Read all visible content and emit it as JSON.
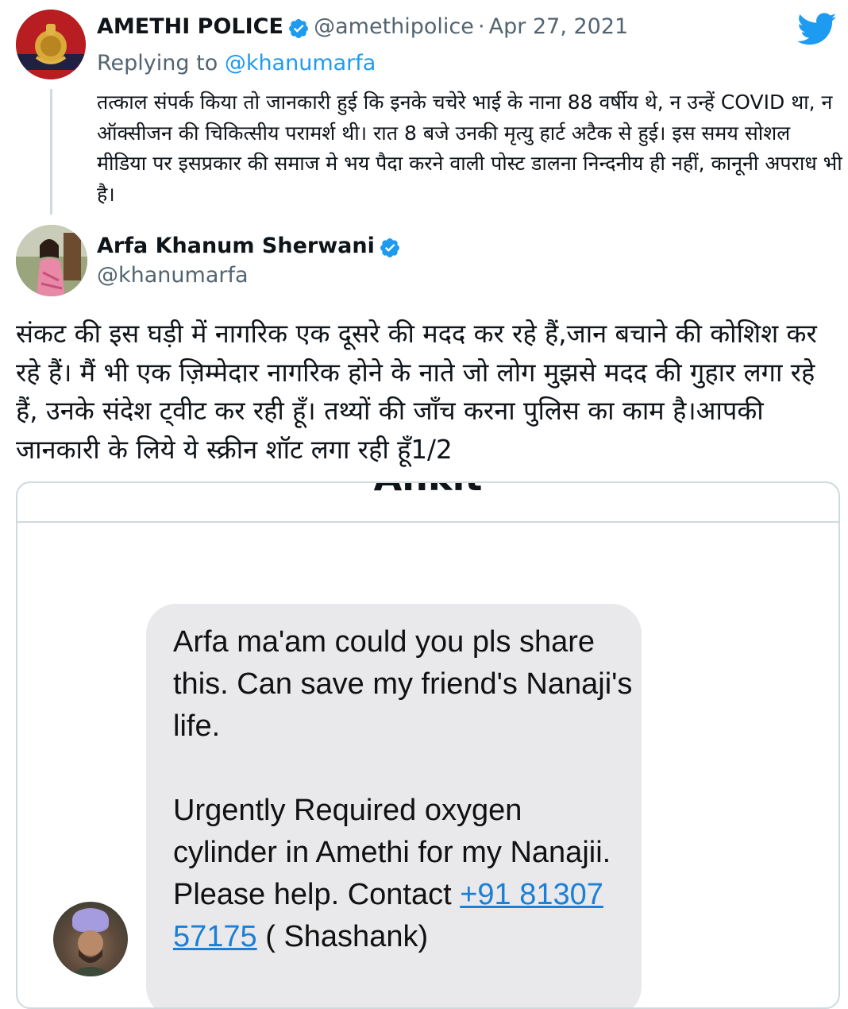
{
  "reply_tweet": {
    "name": "AMETHI POLICE",
    "handle": "@amethipolice",
    "separator": "·",
    "date": "Apr 27, 2021",
    "replying_prefix": "Replying to",
    "replying_to": "@khanumarfa",
    "text": "तत्काल संपर्क किया तो जानकारी हुई कि इनके  चचेरे भाई के नाना 88 वर्षीय थे, न उन्हें COVID था, न ऑक्सीजन की चिकित्सीय परामर्श थी। रात 8 बजे उनकी मृत्यु हार्ट अटैक से हुई। इस समय सोशल मीडिया पर इसप्रकार की समाज मे भय पैदा करने वाली पोस्ट डालना निन्दनीय ही नहीं, कानूनी अपराध भी है।"
  },
  "main_tweet": {
    "name": "Arfa Khanum Sherwani",
    "handle": "@khanumarfa",
    "text": "संकट की इस घड़ी में नागरिक एक दूसरे की मदद कर रहे हैं,जान बचाने की कोशिश कर रहे हैं। मैं भी एक ज़िम्मेदार नागरिक होने के नाते जो लोग मुझसे मदद की गुहार लगा रहे हैं, उनके संदेश ट्वीट कर रही हूँ। तथ्यों की जाँच करना पुलिस का काम है।आपकी जानकारी के लिये ये स्क्रीन शॉट लगा रही हूँ1/2"
  },
  "media": {
    "title": "Ankit",
    "message_text": "Arfa ma'am could you pls share this. Can save my friend's Nanaji's life.\n\nUrgently Required oxygen cylinder  in Amethi for my Nanajii. Please help. Contact ",
    "phone": "+91 81307 57175",
    "message_suffix": " ( Shashank)"
  },
  "icons": {
    "verified": "verified-badge-icon",
    "brand": "twitter-bird-icon"
  },
  "colors": {
    "accent": "#1d9bf0",
    "secondary_text": "#536471",
    "bubble": "#e9e9eb",
    "link": "#1a7fd6"
  }
}
